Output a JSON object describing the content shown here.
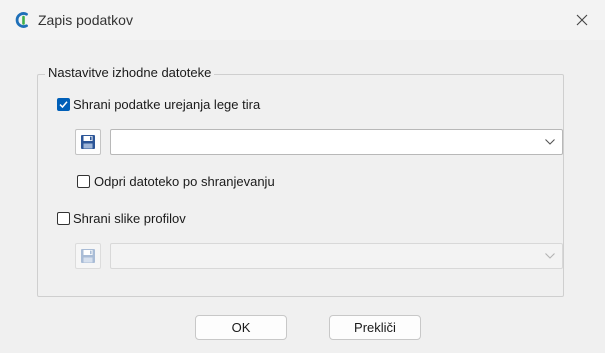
{
  "window": {
    "title": "Zapis podatkov",
    "app_icon": "app-logo-icon",
    "close_icon": "close-icon"
  },
  "group": {
    "legend": "Nastavitve izhodne datoteke",
    "save_track_edit": {
      "label": "Shrani podatke urejanja lege tira",
      "checked": true
    },
    "track_file": {
      "value": "",
      "enabled": true
    },
    "open_after_save": {
      "label": "Odpri datoteko po shranjevanju",
      "checked": false
    },
    "save_profile_images": {
      "label": "Shrani slike profilov",
      "checked": false
    },
    "profile_file": {
      "value": "",
      "enabled": false
    }
  },
  "buttons": {
    "ok": "OK",
    "cancel": "Prekliči"
  },
  "colors": {
    "accent": "#005fb8",
    "save_icon": "#2b5597",
    "dialog_bg": "#f0f0f0"
  }
}
